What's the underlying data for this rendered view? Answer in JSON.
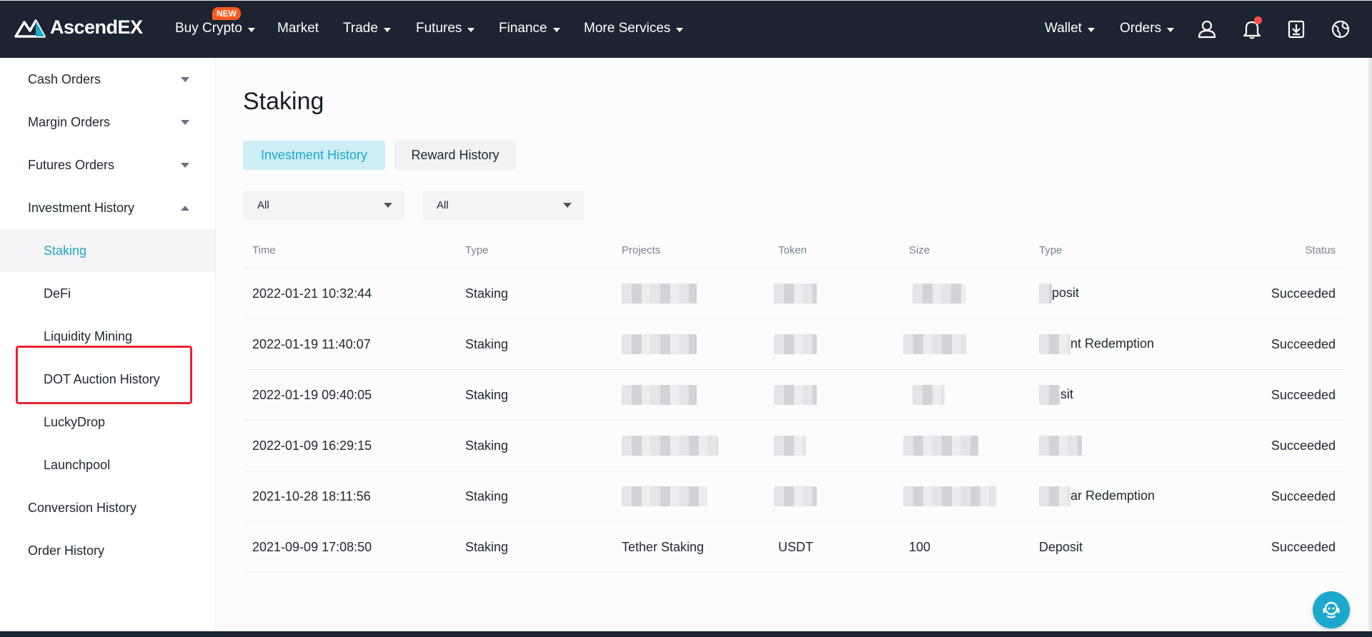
{
  "nav": {
    "logo_text": "AscendEX",
    "new_badge": "NEW",
    "items": [
      {
        "label": "Buy Crypto",
        "has_caret": true
      },
      {
        "label": "Market",
        "has_caret": false
      },
      {
        "label": "Trade",
        "has_caret": true
      },
      {
        "label": "Futures",
        "has_caret": true
      },
      {
        "label": "Finance",
        "has_caret": true
      },
      {
        "label": "More Services",
        "has_caret": true
      }
    ],
    "right_items": [
      {
        "label": "Wallet"
      },
      {
        "label": "Orders"
      }
    ],
    "icons": [
      "user-icon",
      "bell-icon",
      "download-icon",
      "globe-icon"
    ],
    "colors": {
      "bg": "#1c2431",
      "badge": "#ff5a1f",
      "notification_dot": "#ff4d4f"
    }
  },
  "sidebar": {
    "items": [
      {
        "label": "Cash Orders",
        "expand": "down"
      },
      {
        "label": "Margin Orders",
        "expand": "down"
      },
      {
        "label": "Futures Orders",
        "expand": "down"
      },
      {
        "label": "Investment History",
        "expand": "up"
      }
    ],
    "subitems": [
      {
        "label": "Staking",
        "active": true
      },
      {
        "label": "DeFi",
        "active": false
      },
      {
        "label": "Liquidity Mining",
        "active": false
      },
      {
        "label": "DOT Auction History",
        "active": false
      },
      {
        "label": "LuckyDrop",
        "active": false
      },
      {
        "label": "Launchpool",
        "active": false
      }
    ],
    "bottom_items": [
      {
        "label": "Conversion History"
      },
      {
        "label": "Order History"
      }
    ],
    "active_color": "#1fa8c9",
    "highlight_color": "#e8232f"
  },
  "main": {
    "title": "Staking",
    "tabs": [
      {
        "label": "Investment History",
        "active": true
      },
      {
        "label": "Reward History",
        "active": false
      }
    ],
    "filters": [
      {
        "value": "All"
      },
      {
        "value": "All"
      }
    ],
    "table": {
      "headers": [
        "Time",
        "Type",
        "Projects",
        "Token",
        "Size",
        "Type",
        "Status"
      ],
      "rows": [
        {
          "time": "2022-01-21 10:32:44",
          "type": "Staking",
          "project": "",
          "token": "",
          "size": "",
          "type2": "posit",
          "status": "Succeeded"
        },
        {
          "time": "2022-01-19 11:40:07",
          "type": "Staking",
          "project": "",
          "token": "",
          "size": "",
          "type2": "nt Redemption",
          "status": "Succeeded"
        },
        {
          "time": "2022-01-19 09:40:05",
          "type": "Staking",
          "project": "",
          "token": "",
          "size": "",
          "type2": "sit",
          "status": "Succeeded"
        },
        {
          "time": "2022-01-09 16:29:15",
          "type": "Staking",
          "project": "",
          "token": "",
          "size": "",
          "type2": "",
          "status": "Succeeded"
        },
        {
          "time": "2021-10-28 18:11:56",
          "type": "Staking",
          "project": "",
          "token": "",
          "size": "",
          "type2": "ar Redemption",
          "status": "Succeeded"
        },
        {
          "time": "2021-09-09 17:08:50",
          "type": "Staking",
          "project": "Tether Staking",
          "token": "USDT",
          "size": "100",
          "type2": "Deposit",
          "status": "Succeeded"
        }
      ]
    }
  },
  "fab": {
    "icon": "support-icon",
    "color": "#1ba8cc"
  }
}
